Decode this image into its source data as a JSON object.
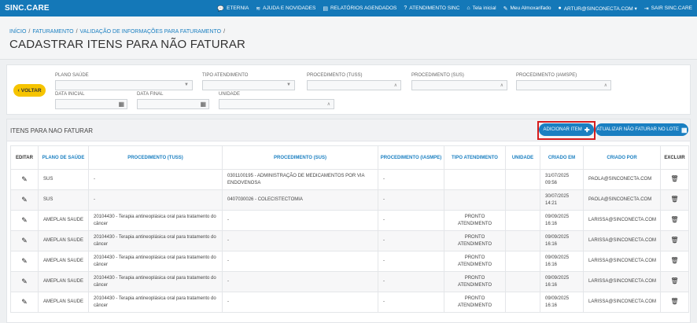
{
  "topbar": {
    "brand": "SINC.CARE",
    "nav": [
      {
        "icon": "chat-icon",
        "glyph": "💬",
        "label": "ETERNIA"
      },
      {
        "icon": "rss-icon",
        "glyph": "≋",
        "label": "AJUDA E NOVIDADES"
      },
      {
        "icon": "calendar-icon",
        "glyph": "▤",
        "label": "RELATÓRIOS AGENDADOS"
      },
      {
        "icon": "help-icon",
        "glyph": "?",
        "label": "ATENDIMENTO SINC"
      },
      {
        "icon": "home-icon",
        "glyph": "⌂",
        "label": "Tela inicial"
      },
      {
        "icon": "edit-icon",
        "glyph": "✎",
        "label": "Meu Almoxarifado"
      },
      {
        "icon": "user-icon",
        "glyph": "●",
        "label": "ARTUR@SINCONECTA.COM ▾"
      },
      {
        "icon": "logout-icon",
        "glyph": "⇥",
        "label": "SAIR SINC.CARE"
      }
    ]
  },
  "breadcrumb": {
    "items": [
      "INÍCIO",
      "FATURAMENTO",
      "VALIDAÇÃO DE INFORMAÇÕES PARA FATURAMENTO"
    ],
    "separator": "/"
  },
  "page_title": "CADASTRAR ITENS PARA NÃO FATURAR",
  "filters": {
    "back_label": "VOLTAR",
    "plano_saude": "PLANO SAÚDE",
    "tipo_atendimento": "TIPO ATENDIMENTO",
    "procedimento_tuss": "PROCEDIMENTO (TUSS)",
    "procedimento_sus": "PROCEDIMENTO (SUS)",
    "procedimento_iamspe": "PROCEDIMENTO (IAMSPE)",
    "data_inicial": "DATA INICIAL",
    "data_final": "DATA FINAL",
    "unidade": "UNIDADE"
  },
  "panel": {
    "title": "ITENS PARA NAO FATURAR",
    "add_label": "ADICIONAR ITEM",
    "update_label": "ATUALIZAR NÃO FATURAR NO LOTE"
  },
  "table": {
    "headers": {
      "editar": "EDITAR",
      "plano": "PLANO DE SAÚDE",
      "tuss": "PROCEDIMENTO (TUSS)",
      "sus": "PROCEDIMENTO (SUS)",
      "iamspe": "PROCEDIMENTO (IASMPE)",
      "tipo": "TIPO ATENDIMENTO",
      "unidade": "UNIDADE",
      "criado_em": "CRIADO EM",
      "criado_por": "CRIADO POR",
      "excluir": "EXCLUIR"
    },
    "rows": [
      {
        "plano": "SUS",
        "tuss": "-",
        "sus": "0301100195 - ADMINISTRAÇÃO DE MEDICAMENTOS POR VIA ENDOVENOSA",
        "iamspe": "-",
        "tipo": "",
        "unidade": "",
        "criado_em": "31/07/2025 09:56",
        "criado_por": "PAOLA@SINCONECTA.COM"
      },
      {
        "plano": "SUS",
        "tuss": "-",
        "sus": "0407030026 - COLECISTECTOMIA",
        "iamspe": "-",
        "tipo": "",
        "unidade": "",
        "criado_em": "30/07/2025 14:21",
        "criado_por": "PAOLA@SINCONECTA.COM"
      },
      {
        "plano": "AMEPLAN SAUDE",
        "tuss": "20104430 - Terapia antineoplásica oral para tratamento do câncer",
        "sus": "-",
        "iamspe": "-",
        "tipo": "PRONTO ATENDIMENTO",
        "unidade": "",
        "criado_em": "09/09/2025 16:16",
        "criado_por": "LARISSA@SINCONECTA.COM"
      },
      {
        "plano": "AMEPLAN SAUDE",
        "tuss": "20104430 - Terapia antineoplásica oral para tratamento do câncer",
        "sus": "-",
        "iamspe": "-",
        "tipo": "PRONTO ATENDIMENTO",
        "unidade": "",
        "criado_em": "09/09/2025 16:16",
        "criado_por": "LARISSA@SINCONECTA.COM"
      },
      {
        "plano": "AMEPLAN SAUDE",
        "tuss": "20104430 - Terapia antineoplásica oral para tratamento do câncer",
        "sus": "-",
        "iamspe": "-",
        "tipo": "PRONTO ATENDIMENTO",
        "unidade": "",
        "criado_em": "09/09/2025 16:16",
        "criado_por": "LARISSA@SINCONECTA.COM"
      },
      {
        "plano": "AMEPLAN SAUDE",
        "tuss": "20104430 - Terapia antineoplásica oral para tratamento do câncer",
        "sus": "-",
        "iamspe": "-",
        "tipo": "PRONTO ATENDIMENTO",
        "unidade": "",
        "criado_em": "09/09/2025 16:16",
        "criado_por": "LARISSA@SINCONECTA.COM"
      },
      {
        "plano": "AMEPLAN SAUDE",
        "tuss": "20104430 - Terapia antineoplásica oral para tratamento do câncer",
        "sus": "-",
        "iamspe": "-",
        "tipo": "PRONTO ATENDIMENTO",
        "unidade": "",
        "criado_em": "09/09/2025 16:16",
        "criado_por": "LARISSA@SINCONECTA.COM"
      }
    ]
  },
  "colors": {
    "primary": "#1a7fc1",
    "topbar": "#1478b8",
    "accent_yellow": "#f6c400",
    "highlight_red": "#d61d1d"
  }
}
